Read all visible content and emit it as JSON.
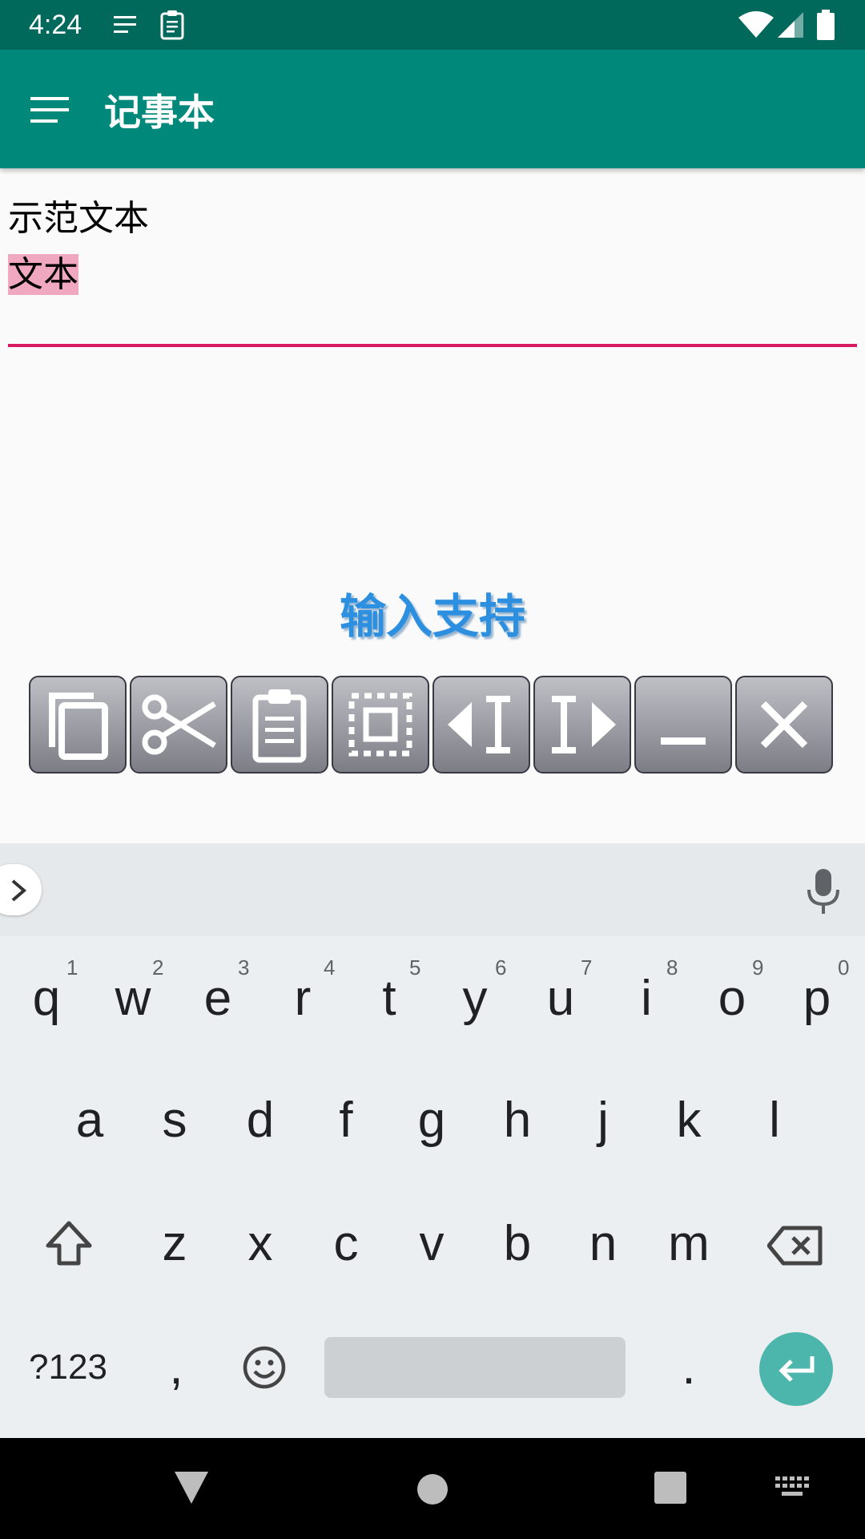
{
  "status_bar": {
    "time": "4:24"
  },
  "app_bar": {
    "title": "记事本"
  },
  "editor": {
    "line1": "示范文本",
    "line2_selected": "文本"
  },
  "support_label": "输入支持",
  "toolbar_icons": [
    "copy-icon",
    "cut-icon",
    "paste-icon",
    "select-all-icon",
    "cursor-left-icon",
    "cursor-right-icon",
    "minimize-icon",
    "close-icon"
  ],
  "keyboard": {
    "row1": [
      {
        "key": "q",
        "hint": "1"
      },
      {
        "key": "w",
        "hint": "2"
      },
      {
        "key": "e",
        "hint": "3"
      },
      {
        "key": "r",
        "hint": "4"
      },
      {
        "key": "t",
        "hint": "5"
      },
      {
        "key": "y",
        "hint": "6"
      },
      {
        "key": "u",
        "hint": "7"
      },
      {
        "key": "i",
        "hint": "8"
      },
      {
        "key": "o",
        "hint": "9"
      },
      {
        "key": "p",
        "hint": "0"
      }
    ],
    "row2": [
      "a",
      "s",
      "d",
      "f",
      "g",
      "h",
      "j",
      "k",
      "l"
    ],
    "row3": [
      "z",
      "x",
      "c",
      "v",
      "b",
      "n",
      "m"
    ],
    "symbols_label": "?123",
    "comma": ",",
    "period": "."
  },
  "colors": {
    "status_bar": "#00695c",
    "app_bar": "#00897b",
    "accent": "#d81b60",
    "enter": "#4db6ac"
  }
}
